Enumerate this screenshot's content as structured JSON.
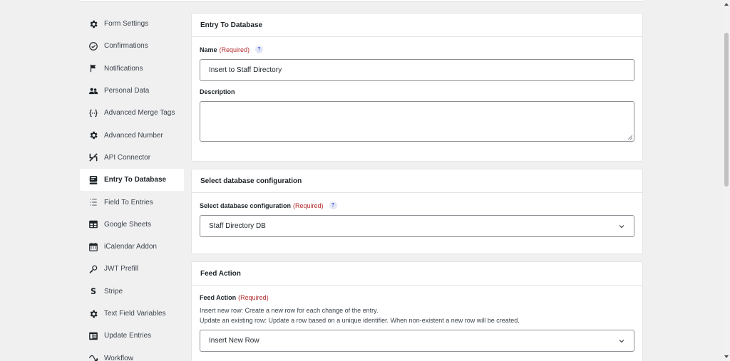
{
  "sidebar": {
    "items": [
      {
        "label": "Form Settings",
        "icon": "gear-icon"
      },
      {
        "label": "Confirmations",
        "icon": "check-circle-icon"
      },
      {
        "label": "Notifications",
        "icon": "flag-icon"
      },
      {
        "label": "Personal Data",
        "icon": "users-icon"
      },
      {
        "label": "Advanced Merge Tags",
        "icon": "braces-icon"
      },
      {
        "label": "Advanced Number",
        "icon": "gear-icon"
      },
      {
        "label": "API Connector",
        "icon": "connector-icon"
      },
      {
        "label": "Entry To Database",
        "icon": "database-icon"
      },
      {
        "label": "Field To Entries",
        "icon": "list-icon"
      },
      {
        "label": "Google Sheets",
        "icon": "table-icon"
      },
      {
        "label": "iCalendar Addon",
        "icon": "calendar-icon"
      },
      {
        "label": "JWT Prefill",
        "icon": "key-icon"
      },
      {
        "label": "Stripe",
        "icon": "stripe-icon"
      },
      {
        "label": "Text Field Variables",
        "icon": "gear-icon"
      },
      {
        "label": "Update Entries",
        "icon": "update-icon"
      },
      {
        "label": "Workflow",
        "icon": "workflow-icon"
      }
    ],
    "active_index": 7
  },
  "panel1": {
    "title": "Entry To Database",
    "name_label": "Name",
    "required": "(Required)",
    "help": "?",
    "name_value": "Insert to Staff Directory",
    "description_label": "Description",
    "description_value": ""
  },
  "panel2": {
    "title": "Select database configuration",
    "field_label": "Select database configuration",
    "required": "(Required)",
    "help": "?",
    "selected": "Staff Directory DB"
  },
  "panel3": {
    "title": "Feed Action",
    "field_label": "Feed Action",
    "required": "(Required)",
    "help_line1": "Insert new row: Create a new row for each change of the entry.",
    "help_line2": "Update an existing row: Update a row based on a unique identifier. When non-existent a new row will be created.",
    "selected": "Insert New Row"
  },
  "colors": {
    "accent": "#3858e9",
    "required": "#b32d2e",
    "background": "#f0f0f1"
  }
}
